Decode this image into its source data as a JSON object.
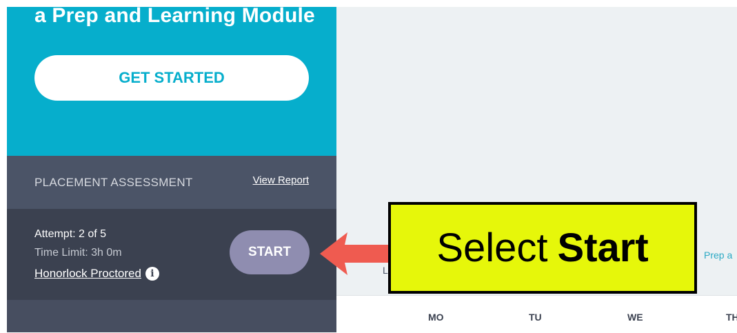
{
  "hero": {
    "title": "a Prep and Learning Module",
    "get_started_label": "GET STARTED"
  },
  "placement": {
    "title": "PLACEMENT ASSESSMENT",
    "view_report_label": "View Report",
    "attempt": "Attempt: 2 of 5",
    "time_limit": "Time Limit: 3h 0m",
    "proctor_label": "Honorlock Proctored",
    "info_icon": "info-icon",
    "start_label": "START"
  },
  "calendar": {
    "days": [
      "MO",
      "TU",
      "WE",
      "TH"
    ],
    "prep_snippet": "Prep a",
    "l_snippet": "L"
  },
  "callout": {
    "text_regular": "Select",
    "text_bold": "Start",
    "arrow_color": "#ef5b50",
    "box_color": "#e6f70a"
  },
  "colors": {
    "brand_teal": "#06aecc",
    "panel_dark": "#3b4150",
    "panel_mid": "#4b5467",
    "start_button": "#8f8db0"
  }
}
